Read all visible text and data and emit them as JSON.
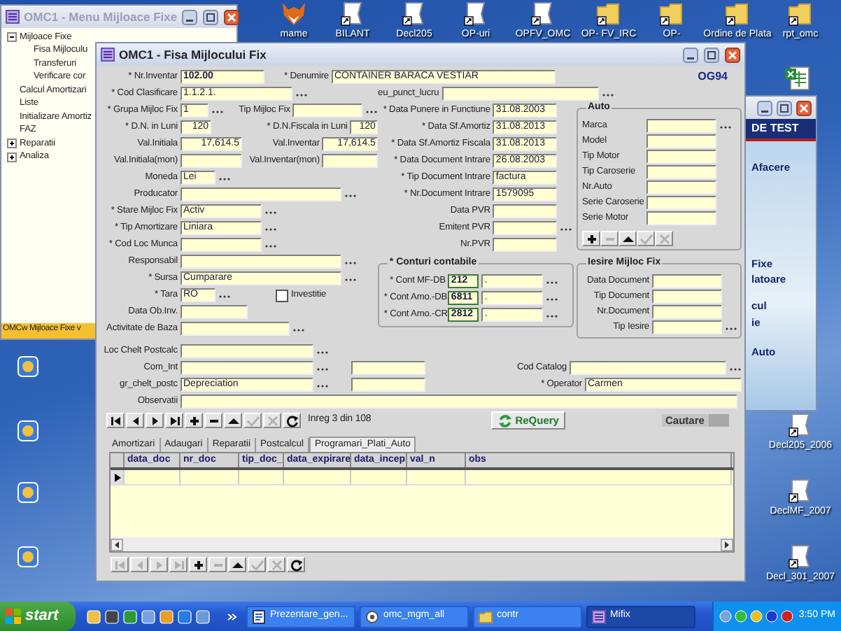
{
  "desktop_icons": [
    {
      "kind": "fox",
      "label": "mame"
    },
    {
      "kind": "shortcut",
      "label": "BILANT"
    },
    {
      "kind": "shortcut",
      "label": "Decl205"
    },
    {
      "kind": "shortcut",
      "label": "OP-uri"
    },
    {
      "kind": "shortcut",
      "label": "OPFV_OMC"
    },
    {
      "kind": "folder",
      "label": "OP- FV_IRC"
    },
    {
      "kind": "folder",
      "label": "OP-"
    },
    {
      "kind": "folder",
      "label": "Ordine de Plata"
    },
    {
      "kind": "folder",
      "label": "rpt_omc"
    },
    {
      "kind": "spreadsheet"
    },
    {
      "kind": "shortcut",
      "label": "Decl205_2006"
    },
    {
      "kind": "shortcut",
      "label": "DeclMF_2007"
    },
    {
      "kind": "shortcut",
      "label": "Decl_301_2007"
    },
    {
      "kind": "app"
    },
    {
      "kind": "app"
    },
    {
      "kind": "app"
    },
    {
      "kind": "app"
    }
  ],
  "menu_window": {
    "title": "OMC1 - Menu Mijloace Fixe",
    "tree": [
      {
        "label": "Mijloace Fixe",
        "expanded": true,
        "children": [
          {
            "label": "Fisa Mijloculu"
          },
          {
            "label": "Transferuri"
          },
          {
            "label": "Verificare cor"
          }
        ]
      },
      {
        "label": "Calcul Amortizari"
      },
      {
        "label": "Liste"
      },
      {
        "label": "Initializare Amortiz"
      },
      {
        "label": "FAZ"
      },
      {
        "label": "Reparatii",
        "expanded": false
      },
      {
        "label": "Analiza",
        "expanded": false
      }
    ],
    "status": "OMCw Mijloace Fixe v"
  },
  "side_window": {
    "heading": "DE TEST",
    "lines": [
      "Afacere",
      "Fixe",
      "latoare",
      "cul",
      "ie",
      "Auto"
    ]
  },
  "dialog": {
    "title": "OMC1 - Fisa Mijlocului Fix",
    "code": "OG94",
    "header_rows": [
      [
        {
          "kind": "input",
          "label": "* Nr.Inventar",
          "value": "102.00"
        },
        {
          "kind": "input",
          "label": "* Denumire",
          "value": "CONTAINER BARACA VESTIAR"
        }
      ],
      [
        {
          "kind": "input",
          "label": "* Cod Clasificare",
          "value": "1.1.2.1.",
          "lookup": true
        },
        {
          "kind": "input",
          "label": "eu_punct_lucru",
          "lookup": true
        }
      ]
    ],
    "left_rows": [
      [
        {
          "kind": "input",
          "label": "* Grupa Mijloc Fix",
          "value": "1",
          "lookup": true
        },
        {
          "kind": "input",
          "label": "Tip Mijloc Fix",
          "lookup": true
        }
      ],
      [
        {
          "kind": "input",
          "label": "* D.N. in Luni",
          "value": "120"
        },
        {
          "kind": "input",
          "label": "* D.N.Fiscala in Luni",
          "value": "120"
        }
      ],
      [
        {
          "kind": "input",
          "label": "Val.Initiala",
          "value": "17,614.5"
        },
        {
          "kind": "input",
          "label": "Val.Inventar",
          "value": "17,614.5"
        }
      ],
      [
        {
          "kind": "input",
          "label": "Val.Initiala(mon)"
        },
        {
          "kind": "input",
          "label": "Val.Inventar(mon)"
        }
      ],
      [
        {
          "kind": "input",
          "label": "Moneda",
          "value": "Lei",
          "lookup": true
        }
      ],
      [
        {
          "kind": "input",
          "label": "Producator",
          "lookup": true
        }
      ],
      [
        {
          "kind": "input",
          "label": "* Stare Mijloc Fix",
          "value": "Activ",
          "lookup": true
        }
      ],
      [
        {
          "kind": "input",
          "label": "* Tip Amortizare",
          "value": "Liniara",
          "lookup": true
        }
      ],
      [
        {
          "kind": "input",
          "label": "* Cod Loc Munca",
          "lookup": true
        }
      ],
      [
        {
          "kind": "input",
          "label": "Responsabil",
          "lookup": true
        }
      ],
      [
        {
          "kind": "input",
          "label": "* Sursa",
          "value": "Cumparare",
          "lookup": true
        }
      ],
      [
        {
          "kind": "input",
          "label": "* Tara",
          "value": "RO",
          "lookup": true
        },
        {
          "kind": "checkbox",
          "label": "Investitie",
          "checked": false
        }
      ],
      [
        {
          "kind": "input",
          "label": "Data Ob.Inv."
        }
      ],
      [
        {
          "kind": "input",
          "label": "Activitate de Baza",
          "lookup": true
        }
      ]
    ],
    "middle_fields": [
      {
        "kind": "input",
        "label": "* Data Punere in Functiune",
        "value": "31.08.2003"
      },
      {
        "kind": "input",
        "label": "* Data Sf.Amortiz",
        "value": "31.08.2013"
      },
      {
        "kind": "input",
        "label": "* Data Sf.Amortiz Fiscala",
        "value": "31.08.2013"
      },
      {
        "kind": "input",
        "label": "* Data Document Intrare",
        "value": "26.08.2003"
      },
      {
        "kind": "input",
        "label": "* Tip Document Intrare",
        "value": "factura"
      },
      {
        "kind": "input",
        "label": "* Nr.Document Intrare",
        "value": "1579095"
      },
      {
        "kind": "input",
        "label": "Data PVR"
      },
      {
        "kind": "input",
        "label": "Emitent PVR",
        "lookup": true
      },
      {
        "kind": "input",
        "label": "Nr.PVR"
      }
    ],
    "accounts": {
      "title": "* Conturi contabile",
      "rows": [
        {
          "label": "* Cont MF-DB",
          "account": "212",
          "detail": ".",
          "lookup": true
        },
        {
          "label": "* Cont Amo.-DB",
          "account": "6811",
          "detail": ".",
          "lookup": true
        },
        {
          "label": "* Cont Amo.-CR",
          "account": "2812",
          "detail": ".",
          "lookup": true
        }
      ]
    },
    "auto": {
      "title": "Auto",
      "fields": [
        {
          "kind": "input",
          "label": "Marca",
          "lookup": true
        },
        {
          "kind": "input",
          "label": "Model"
        },
        {
          "kind": "input",
          "label": "Tip Motor"
        },
        {
          "kind": "input",
          "label": "Tip Caroserie"
        },
        {
          "kind": "input",
          "label": "Nr.Auto"
        },
        {
          "kind": "input",
          "label": "Serie Caroserie"
        },
        {
          "kind": "input",
          "label": "Serie Motor"
        }
      ],
      "buttons": [
        {
          "kind": "add",
          "disabled": false
        },
        {
          "kind": "delete",
          "disabled": true
        },
        {
          "kind": "up",
          "disabled": false
        },
        {
          "kind": "save",
          "disabled": true
        },
        {
          "kind": "undo",
          "disabled": true
        }
      ]
    },
    "exit": {
      "title": "Iesire Mijloc Fix",
      "fields": [
        {
          "kind": "input",
          "label": "Data Document"
        },
        {
          "kind": "input",
          "label": "Tip Document"
        },
        {
          "kind": "input",
          "label": "Nr.Document"
        },
        {
          "kind": "input",
          "label": "Tip Iesire",
          "lookup": true
        }
      ]
    },
    "bottom_rows": [
      [
        {
          "kind": "input",
          "label": "Loc Chelt Postcalc",
          "lookup": true
        }
      ],
      [
        {
          "kind": "input",
          "label": "Com_Int",
          "lookup": true
        },
        {
          "kind": "input"
        }
      ],
      [
        {
          "kind": "input",
          "label": "gr_chelt_postc",
          "value": "Depreciation",
          "lookup": true
        },
        {
          "kind": "input"
        }
      ]
    ],
    "bottom_right": [
      {
        "kind": "input",
        "label": "Cod Catalog",
        "lookup": true
      },
      {
        "kind": "input",
        "label": "* Operator",
        "value": "Carmen"
      }
    ],
    "notes": {
      "kind": "input",
      "label": "Observatii"
    },
    "navigator": {
      "buttons": [
        {
          "kind": "first",
          "disabled": false
        },
        {
          "kind": "prev",
          "disabled": false
        },
        {
          "kind": "next",
          "disabled": false
        },
        {
          "kind": "last",
          "disabled": false
        },
        {
          "kind": "add",
          "disabled": false
        },
        {
          "kind": "delete",
          "disabled": false
        },
        {
          "kind": "up",
          "disabled": false
        },
        {
          "kind": "save",
          "disabled": true
        },
        {
          "kind": "undo",
          "disabled": true
        },
        {
          "kind": "refresh",
          "disabled": false
        }
      ],
      "record": "Inreg 3 din 108"
    },
    "requery": "ReQuery",
    "search_label": "Cautare",
    "tabs": [
      {
        "label": "Amortizari",
        "selected": false
      },
      {
        "label": "Adaugari",
        "selected": false
      },
      {
        "label": "Reparatii",
        "selected": false
      },
      {
        "label": "Postcalcul",
        "selected": false
      },
      {
        "label": "Programari_Plati_Auto",
        "selected": true
      }
    ],
    "grid": {
      "columns": [
        "data_doc",
        "nr_doc",
        "tip_doc_",
        "data_expirare",
        "data_incep",
        "val_n",
        "obs"
      ],
      "current_row_marker": true
    },
    "grid_navigator": {
      "buttons": [
        {
          "kind": "first",
          "disabled": true
        },
        {
          "kind": "prev",
          "disabled": true
        },
        {
          "kind": "next",
          "disabled": true
        },
        {
          "kind": "last",
          "disabled": true
        },
        {
          "kind": "add",
          "disabled": false
        },
        {
          "kind": "delete",
          "disabled": true
        },
        {
          "kind": "up",
          "disabled": false
        },
        {
          "kind": "save",
          "disabled": true
        },
        {
          "kind": "undo",
          "disabled": true
        },
        {
          "kind": "refresh",
          "disabled": false
        }
      ]
    }
  },
  "taskbar": {
    "start": "start",
    "tasks": [
      {
        "kind": "document",
        "label": "Prezentare_gen...",
        "active": false
      },
      {
        "kind": "browser",
        "label": "omc_mgm_all",
        "active": false
      },
      {
        "kind": "folder",
        "label": "contr",
        "active": false
      },
      {
        "kind": "app",
        "label": "Mifix",
        "active": true
      }
    ],
    "clock": "3:50 PM"
  }
}
